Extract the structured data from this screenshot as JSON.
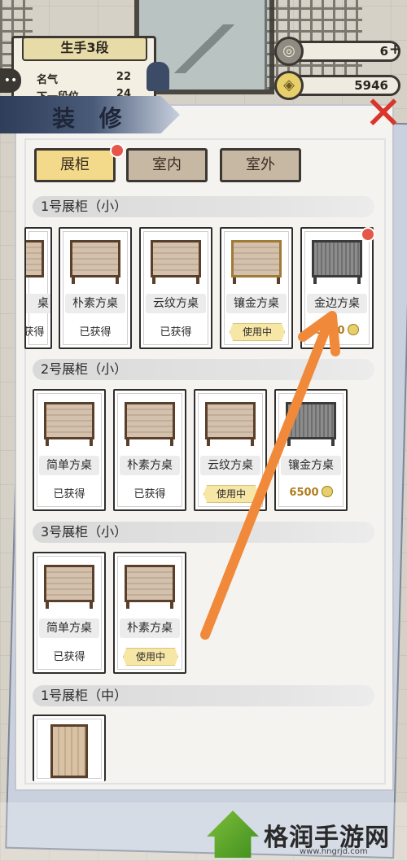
{
  "hud": {
    "rank_title": "生手3段",
    "fame_label": "名气",
    "fame_value": "22",
    "next_label": "下一段位",
    "next_value": "24",
    "gems": "6",
    "coins": "5946"
  },
  "panel": {
    "title": "装 修",
    "tabs": [
      {
        "label": "展柜",
        "active": true
      },
      {
        "label": "室内",
        "active": false
      },
      {
        "label": "室外",
        "active": false
      }
    ]
  },
  "sections": [
    {
      "title": "1号展柜（小）",
      "items": [
        {
          "name": "桌",
          "status": "已获得"
        },
        {
          "name": "朴素方桌",
          "status": "已获得"
        },
        {
          "name": "云纹方桌",
          "status": "已获得"
        },
        {
          "name": "镶金方桌",
          "status": "使用中"
        },
        {
          "name": "金边方桌",
          "price": "5500"
        }
      ]
    },
    {
      "title": "2号展柜（小）",
      "items": [
        {
          "name": "简单方桌",
          "status": "已获得"
        },
        {
          "name": "朴素方桌",
          "status": "已获得"
        },
        {
          "name": "云纹方桌",
          "status": "使用中"
        },
        {
          "name": "镶金方桌",
          "price": "6500"
        }
      ]
    },
    {
      "title": "3号展柜（小）",
      "items": [
        {
          "name": "简单方桌",
          "status": "已获得"
        },
        {
          "name": "朴素方桌",
          "status": "使用中"
        }
      ]
    },
    {
      "title": "1号展柜（中）",
      "items": []
    }
  ],
  "watermark": {
    "text": "格润手游网",
    "url": "www.hngrjd.com"
  },
  "colors": {
    "active_tab": "#f3da8a",
    "arrow": "#f08a3a",
    "close": "#d9352b"
  }
}
